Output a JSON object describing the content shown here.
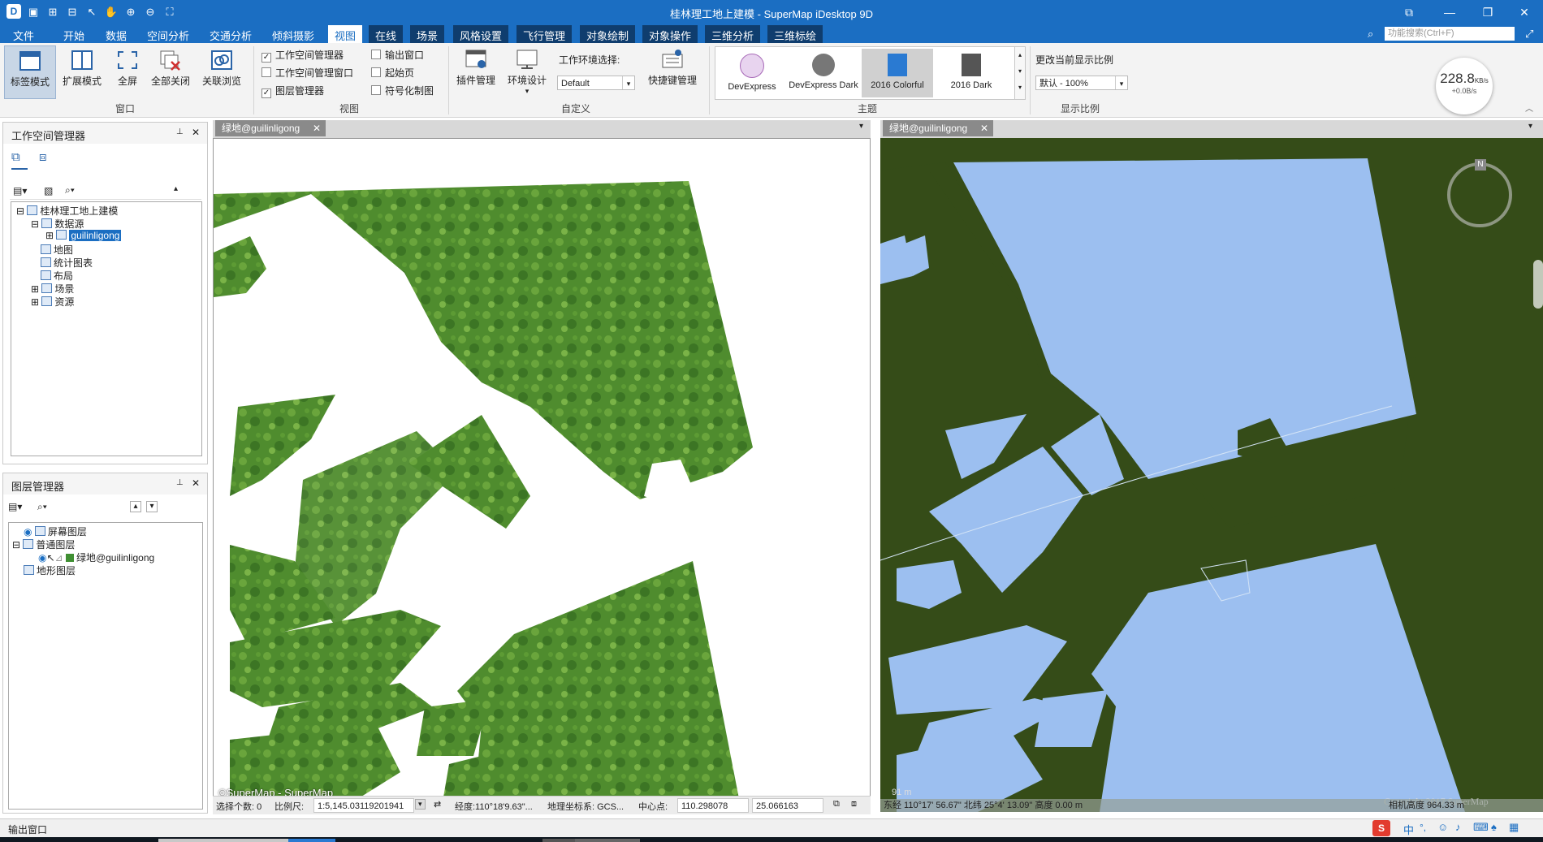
{
  "window": {
    "title": "桂林理工地上建模 - SuperMap iDesktop 9D",
    "buttons": [
      "restore-icon",
      "minimize-icon",
      "maximize-icon",
      "close-icon"
    ]
  },
  "menu": {
    "items": [
      "文件",
      "开始",
      "数据",
      "空间分析",
      "交通分析",
      "倾斜摄影",
      "视图",
      "在线",
      "场景",
      "风格设置",
      "飞行管理",
      "对象绘制",
      "对象操作",
      "三维分析",
      "三维标绘"
    ],
    "active": "视图",
    "search_placeholder": "功能搜索(Ctrl+F)"
  },
  "ribbon": {
    "window_group": {
      "label": "窗口",
      "buttons": [
        "标签模式",
        "扩展模式",
        "全屏",
        "全部关闭",
        "关联浏览"
      ]
    },
    "view_group": {
      "label": "视图",
      "checks": [
        {
          "label": "工作空间管理器",
          "checked": true
        },
        {
          "label": "工作空间管理窗口",
          "checked": false
        },
        {
          "label": "图层管理器",
          "checked": true
        },
        {
          "label": "输出窗口",
          "checked": false
        },
        {
          "label": "起始页",
          "checked": false
        },
        {
          "label": "符号化制图",
          "checked": false
        }
      ]
    },
    "custom_group": {
      "label": "自定义",
      "plugin": "插件管理",
      "env_design": "环境设计",
      "env_label": "工作环境选择:",
      "env_value": "Default",
      "shortcut": "快捷键管理"
    },
    "theme_group": {
      "label": "主题",
      "themes": [
        "DevExpress",
        "DevExpress Dark",
        "2016 Colorful",
        "2016 Dark"
      ],
      "selected": "2016 Colorful"
    },
    "scale_group": {
      "label": "显示比例",
      "title": "更改当前显示比例",
      "value": "默认 - 100%"
    },
    "net_speed": {
      "value": "228.8",
      "unit": "KB/s",
      "sub": "+0.0B/s"
    }
  },
  "workspace_panel": {
    "title": "工作空间管理器",
    "tree": [
      {
        "label": "桂林理工地上建模",
        "level": 0
      },
      {
        "label": "数据源",
        "level": 1
      },
      {
        "label": "guilinligong",
        "level": 2,
        "selected": true
      },
      {
        "label": "地图",
        "level": 1
      },
      {
        "label": "统计图表",
        "level": 1
      },
      {
        "label": "布局",
        "level": 1
      },
      {
        "label": "场景",
        "level": 1
      },
      {
        "label": "资源",
        "level": 1
      }
    ]
  },
  "layer_panel": {
    "title": "图层管理器",
    "tree": [
      {
        "label": "屏幕图层",
        "level": 0
      },
      {
        "label": "普通图层",
        "level": 0
      },
      {
        "label": "绿地@guilinligong",
        "level": 1
      },
      {
        "label": "地形图层",
        "level": 0
      }
    ]
  },
  "map_left": {
    "tab": "绿地@guilinligong",
    "copyright": "©SuperMap - SuperMap"
  },
  "map_right": {
    "tab": "绿地@guilinligong",
    "compass_label": "N",
    "scale_text": "91 m",
    "copyright": "Copyright 2017 SuperMap",
    "status_text": "东经 110°17' 56.67\"  北纬 25°4' 13.09\"  高度 0.00 m",
    "camera_text": "相机高度 964.33 m"
  },
  "statusbar": {
    "select_label": "选择个数: 0",
    "scale_label": "比例尺:",
    "scale_value": "1:5,145.03119201941",
    "lon_label": "经度:110°18'9.63\"...",
    "crs_label": "地理坐标系: GCS...",
    "center_label": "中心点:",
    "center_x": "110.298078",
    "center_y": "25.066163"
  },
  "output_bar": {
    "label": "输出窗口"
  },
  "taskbar": {
    "ime": "中"
  }
}
